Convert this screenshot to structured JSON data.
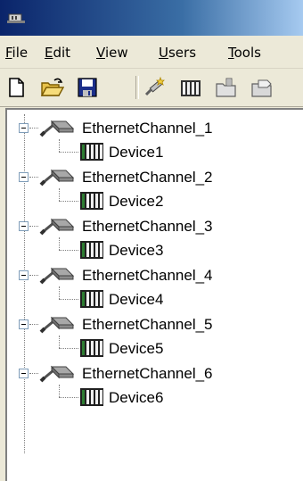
{
  "menu": {
    "file": "File",
    "edit": "Edit",
    "view": "View",
    "users": "Users",
    "tools": "Tools"
  },
  "toolbar": {
    "icons": [
      "new-file-icon",
      "open-folder-icon",
      "save-disk-icon",
      "wizard-icon",
      "new-device-icon",
      "new-group-icon",
      "new-tag-icon"
    ]
  },
  "tree": {
    "channels": [
      {
        "label": "EthernetChannel_1",
        "device": "Device1"
      },
      {
        "label": "EthernetChannel_2",
        "device": "Device2"
      },
      {
        "label": "EthernetChannel_3",
        "device": "Device3"
      },
      {
        "label": "EthernetChannel_4",
        "device": "Device4"
      },
      {
        "label": "EthernetChannel_5",
        "device": "Device5"
      },
      {
        "label": "EthernetChannel_6",
        "device": "Device6"
      }
    ]
  },
  "colors": {
    "titlebar_start": "#0a246a",
    "titlebar_end": "#a6caf0",
    "chrome": "#ece9d8",
    "device_stripes": "#2e7d32"
  }
}
